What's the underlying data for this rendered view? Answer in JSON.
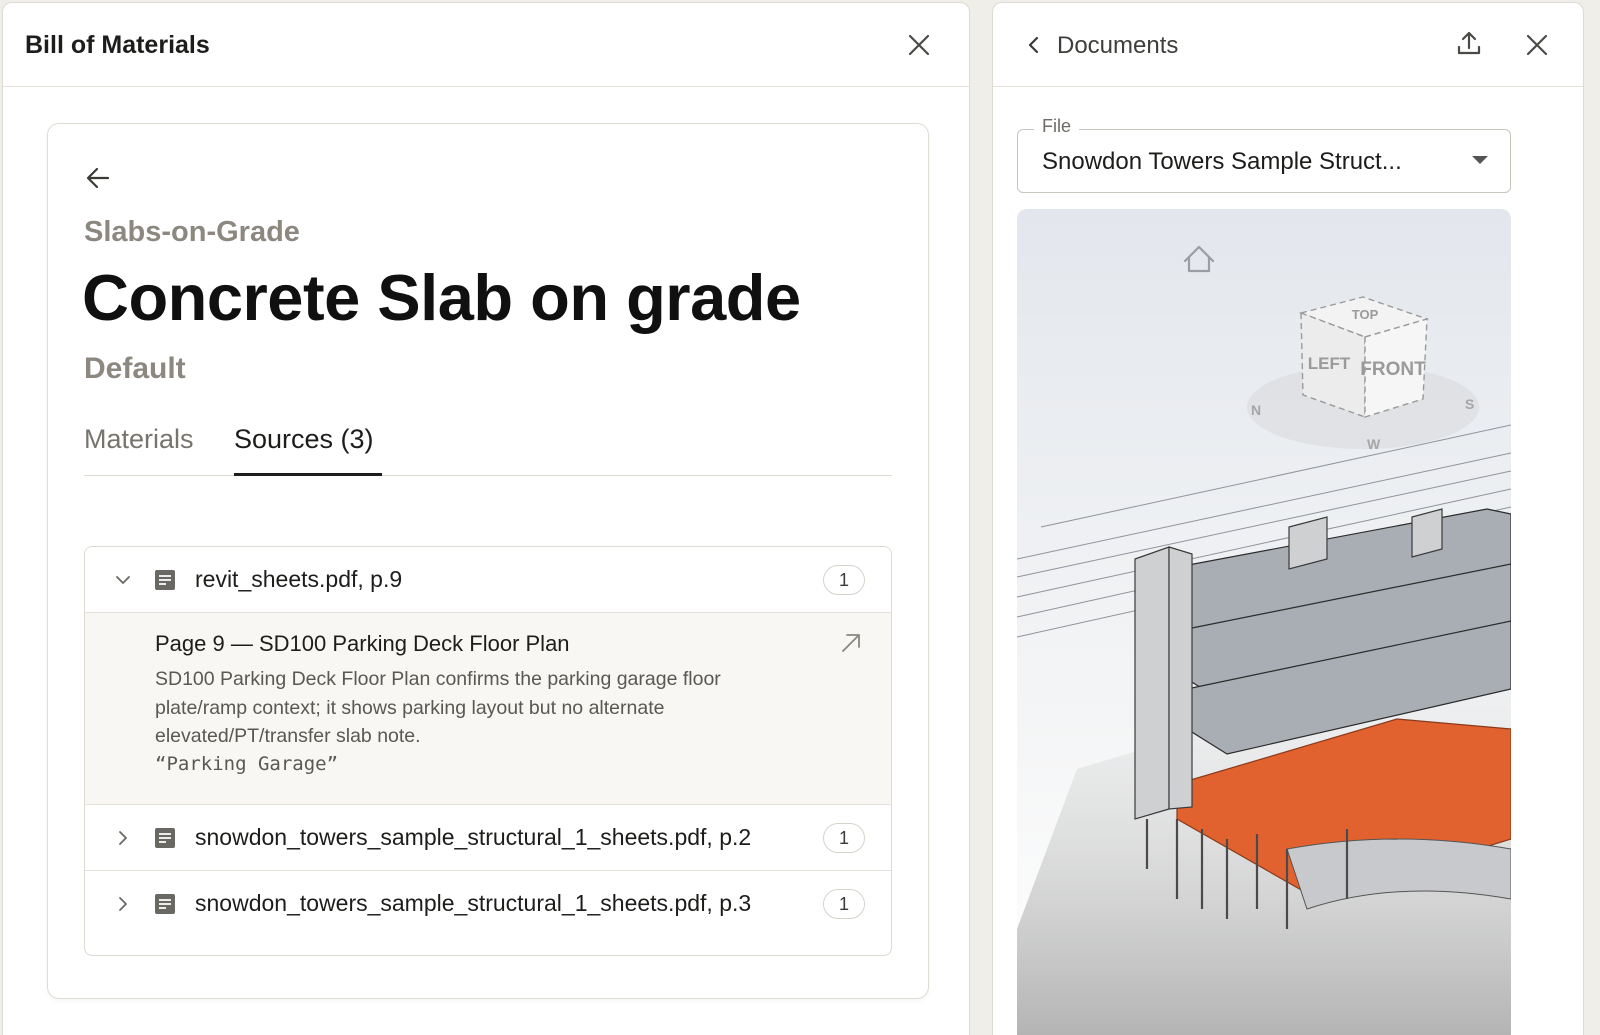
{
  "bom_panel": {
    "title": "Bill of Materials",
    "category": "Slabs-on-Grade",
    "item_title": "Concrete Slab on grade",
    "variant": "Default",
    "tabs": [
      {
        "label": "Materials",
        "active": false
      },
      {
        "label": "Sources (3)",
        "active": true
      }
    ],
    "sources": [
      {
        "name": "revit_sheets.pdf, p.9",
        "count": "1",
        "expanded": true,
        "detail": {
          "title": "Page 9 — SD100 Parking Deck Floor Plan",
          "body": "SD100 Parking Deck Floor Plan confirms the parking garage floor plate/ramp context; it shows parking layout but no alternate elevated/PT/transfer slab note.",
          "quote": "“Parking Garage”"
        }
      },
      {
        "name": "snowdon_towers_sample_structural_1_sheets.pdf, p.2",
        "count": "1",
        "expanded": false
      },
      {
        "name": "snowdon_towers_sample_structural_1_sheets.pdf, p.3",
        "count": "1",
        "expanded": false
      }
    ]
  },
  "docs_panel": {
    "title": "Documents",
    "file_label": "File",
    "file_value": "Snowdon Towers Sample Struct...",
    "viewcube": {
      "top": "TOP",
      "left": "LEFT",
      "front": "FRONT"
    },
    "compass": {
      "n": "N",
      "s": "S",
      "w": "W"
    }
  },
  "icons": {
    "close": "close-icon",
    "back": "arrow-left-icon",
    "chevron_back": "chevron-left-icon",
    "export": "upload-icon",
    "document": "document-icon",
    "open": "arrow-up-right-icon",
    "home": "home-icon"
  },
  "colors": {
    "accent_slab": "#e2622f",
    "muted_text": "#8c8880",
    "border": "#dedbd3"
  }
}
